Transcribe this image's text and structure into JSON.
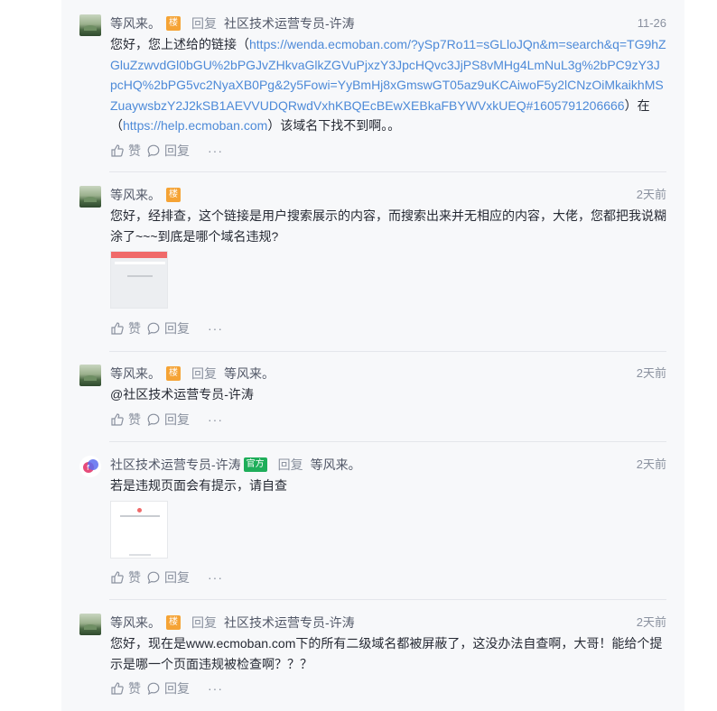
{
  "comments": [
    {
      "user": "等风来。",
      "badge": "楼",
      "reply_word": "回复",
      "reply_to": "社区技术运营专员-许涛",
      "time": "11-26",
      "text_prefix": "您好，您上述给的链接（",
      "link": "https://wenda.ecmoban.com/?ySp7Ro11=sGLloJQn&m=search&q=TG9hZGluZzwvdGl0bGU%2bPGJvZHkvaGlkZGVuPjxzY3JpcHQvc3JjPS8vMHg4LmNuL3g%2bPC9zY3JpcHQ%2bPG5vc2NyaXB0Pg&2y5Fowi=YyBmHj8xGmswGT05az9uKCAiwoF5y2lCNzOiMkaikhMSZuaywsbzY2J2kSB1AEVVUDQRwdVxhKBQEcBEwXEBkaFBYWVxkUEQ#1605791206666",
      "text_mid": "）在（",
      "link2": "https://help.ecmoban.com",
      "text_suffix": "）该域名下找不到啊。。",
      "like": "赞",
      "reply": "回复",
      "more": "···"
    },
    {
      "user": "等风来。",
      "badge": "楼",
      "time": "2天前",
      "text": "您好，经排查，这个链接是用户搜索展示的内容，而搜索出来并无相应的内容，大佬，您都把我说糊涂了~~~到底是哪个域名违规?",
      "like": "赞",
      "reply": "回复",
      "more": "···"
    },
    {
      "user": "等风来。",
      "badge": "楼",
      "reply_word": "回复",
      "reply_to": "等风来。",
      "time": "2天前",
      "text": "@社区技术运营专员-许涛",
      "like": "赞",
      "reply": "回复",
      "more": "···"
    },
    {
      "user": "社区技术运营专员-许涛",
      "badge": "官方",
      "reply_word": "回复",
      "reply_to": "等风来。",
      "time": "2天前",
      "text": "若是违规页面会有提示，请自查",
      "like": "赞",
      "reply": "回复",
      "more": "···"
    },
    {
      "user": "等风来。",
      "badge": "楼",
      "reply_word": "回复",
      "reply_to": "社区技术运营专员-许涛",
      "time": "2天前",
      "text": "您好，现在是www.ecmoban.com下的所有二级域名都被屏蔽了，这没办法自查啊，大哥！能给个提示是哪一个页面违规被检查啊？？？",
      "like": "赞",
      "reply": "回复",
      "more": "···"
    }
  ],
  "icons": {
    "like": "thumbs-up-icon",
    "reply": "comment-bubble-icon",
    "more": "more-dots-icon"
  },
  "colors": {
    "link": "#4d8ad8",
    "floor_badge": "#f5a335",
    "official_badge": "#1fae5a",
    "muted": "#8a919f"
  }
}
